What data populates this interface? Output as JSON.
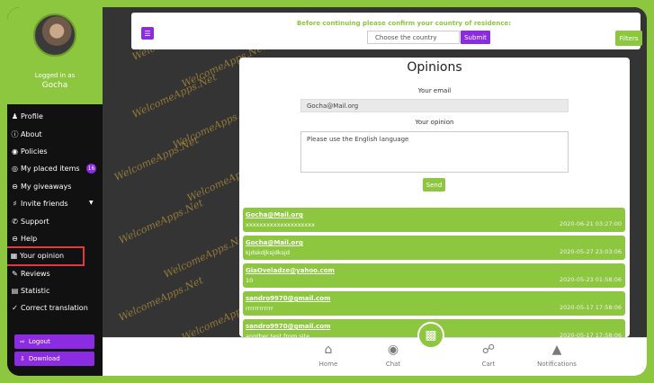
{
  "sidebar": {
    "logged_in_label": "Logged in as",
    "user_name": "Gocha",
    "items": [
      {
        "label": "Profile",
        "icon": "user-icon"
      },
      {
        "label": "About",
        "icon": "info-icon"
      },
      {
        "label": "Policies",
        "icon": "policies-icon"
      },
      {
        "label": "My placed items",
        "icon": "items-icon",
        "badge": "16"
      },
      {
        "label": "My giveaways",
        "icon": "giveaways-icon"
      },
      {
        "label": "Invite friends",
        "icon": "invite-icon"
      },
      {
        "label": "Support",
        "icon": "support-icon"
      },
      {
        "label": "Help",
        "icon": "help-icon"
      },
      {
        "label": "Your opinion",
        "icon": "opinion-icon"
      },
      {
        "label": "Reviews",
        "icon": "reviews-icon"
      },
      {
        "label": "Statistic",
        "icon": "statistic-icon"
      },
      {
        "label": "Correct translation",
        "icon": "translation-icon"
      }
    ],
    "logout_label": "Logout",
    "download_label": "Download"
  },
  "top_panel": {
    "country_message": "Before continuing please confirm your country of residence:",
    "country_placeholder": "Choose the country",
    "submit_label": "Submit",
    "filters_label": "Filters"
  },
  "opinions": {
    "title": "Opinions",
    "email_label": "Your email",
    "email_value": "Gocha@Mail.org",
    "opinion_label": "Your opinion",
    "opinion_placeholder": "Please use the English language",
    "send_label": "Send",
    "items": [
      {
        "email": "Gocha@Mail.org",
        "text": "xxxxxxxxxxxxxxxxxxxx",
        "date": "2020-06-21 03:27:00"
      },
      {
        "email": "Gocha@Mail.org",
        "text": "kjdskdjksjdksjd",
        "date": "2020-05-27 23:03:06"
      },
      {
        "email": "GiaOveladze@yahoo.com",
        "text": "10",
        "date": "2020-05-23 01:58:06"
      },
      {
        "email": "sandro9970@gmail.com",
        "text": "rrrrrrrrrrrr",
        "date": "2020-05-17 17:58:06"
      },
      {
        "email": "sandro9970@gmail.com",
        "text": "anpther test from site",
        "date": "2020-05-17 17:58:06"
      }
    ]
  },
  "bottom_nav": [
    {
      "label": "Home",
      "icon": "home-icon"
    },
    {
      "label": "Chat",
      "icon": "chat-icon"
    },
    {
      "label": "Cart",
      "icon": "cart-icon"
    },
    {
      "label": "Notifications",
      "icon": "bell-icon"
    }
  ],
  "watermark": "WelcomeApps.Net",
  "colors": {
    "accent_green": "#8dc63f",
    "accent_purple": "#8b2be2",
    "highlight_red": "#e53935"
  }
}
